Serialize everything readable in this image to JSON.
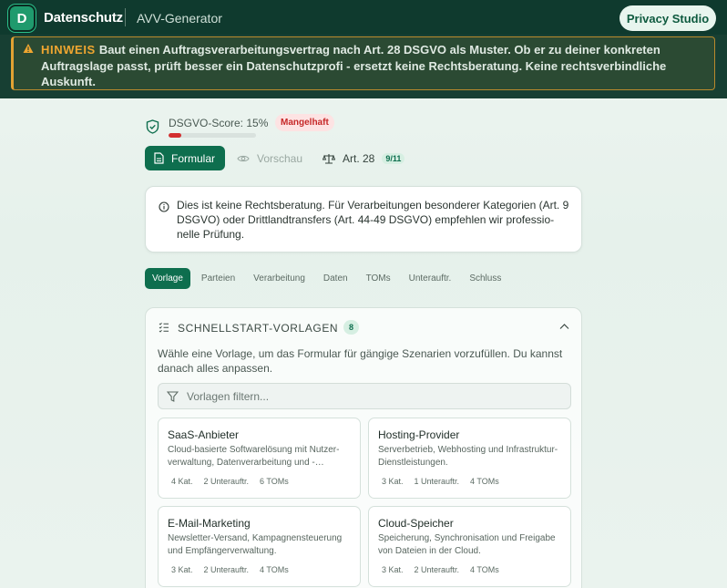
{
  "header": {
    "logo_letter": "D",
    "brand": "Datenschutz",
    "subtitle": "AVV-Generator",
    "studio_button": "Privacy Studio"
  },
  "banner": {
    "label": "HINWEIS",
    "text": "Baut einen Auftragsverarbeitungsvertrag nach Art. 28 DSGVO als Muster. Ob er zu deiner konkreten Auftragslage passt, prüft besser ein Datenschutzprofi - ersetzt keine Rechtsberatung. Keine rechtsverbindliche Auskunft."
  },
  "score": {
    "label": "DSGVO-Score: 15%",
    "value_percent": 15,
    "badge": "Mangelhaft",
    "color": "#d32f2f"
  },
  "modes": {
    "formular": "Formular",
    "vorschau": "Vorschau",
    "art": "Art. 28",
    "art_badge": "9/11"
  },
  "info": {
    "text": "Dies ist keine Rechtsberatung. Für Verarbeitungen besonderer Kategorien (Art. 9 DSGVO) oder Drittlandtransfers (Art. 44-49 DSGVO) empfehlen wir professio-nelle Prüfung."
  },
  "steps": [
    "Vorlage",
    "Parteien",
    "Verarbeitung",
    "Daten",
    "TOMs",
    "Unterauftr.",
    "Schluss"
  ],
  "templates": {
    "title": "SCHNELLSTART-VORLAGEN",
    "count": "8",
    "description": "Wähle eine Vorlage, um das Formular für gängige Szenarien vorzufüllen. Du kannst danach alles anpassen.",
    "filter_placeholder": "Vorlagen filtern...",
    "cards": [
      {
        "title": "SaaS-Anbieter",
        "desc": "Cloud-basierte Softwarelösung mit Nutzer-verwaltung, Datenverarbeitung und -…",
        "kat": "4 Kat.",
        "unter": "2 Unterauftr.",
        "toms": "6 TOMs"
      },
      {
        "title": "Hosting-Provider",
        "desc": "Serverbetrieb, Webhosting und Infrastruktur-Dienstleistungen.",
        "kat": "3 Kat.",
        "unter": "1 Unterauftr.",
        "toms": "4 TOMs"
      },
      {
        "title": "E-Mail-Marketing",
        "desc": "Newsletter-Versand, Kampagnensteuerung und Empfängerverwaltung.",
        "kat": "3 Kat.",
        "unter": "2 Unterauftr.",
        "toms": "4 TOMs"
      },
      {
        "title": "Cloud-Speicher",
        "desc": "Speicherung, Synchronisation und Freigabe von Dateien in der Cloud.",
        "kat": "3 Kat.",
        "unter": "2 Unterauftr.",
        "toms": "4 TOMs"
      }
    ]
  },
  "colors": {
    "primary": "#0e6e4e",
    "header_bg": "#0f3a2e",
    "warning": "#f0a630",
    "danger": "#d32f2f"
  },
  "icons": {
    "logo": "logo-icon",
    "warning": "warning-triangle-icon",
    "score": "shield-check-icon",
    "formular": "document-icon",
    "vorschau": "eye-icon",
    "art": "scale-icon",
    "info": "info-circle-icon",
    "templates": "checklist-icon",
    "collapse": "chevron-up-icon",
    "filter": "filter-icon"
  }
}
